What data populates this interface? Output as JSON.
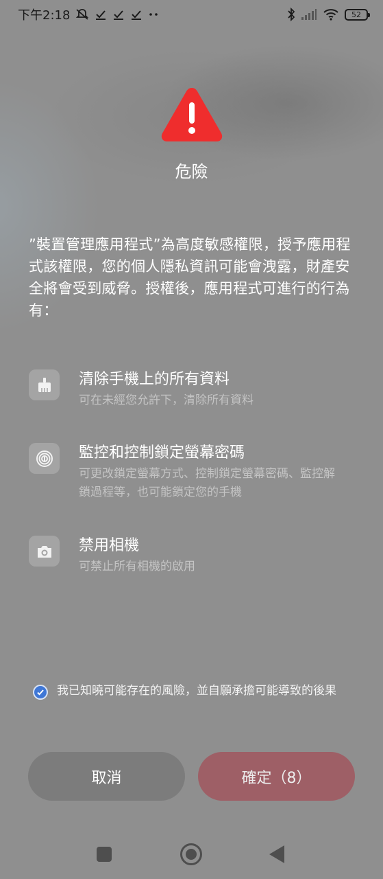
{
  "status_bar": {
    "time": "下午2:18",
    "icons": [
      "mute-bell-icon",
      "check-icon",
      "check-icon",
      "check-icon",
      "more-dots-icon"
    ],
    "right_icons": [
      "bluetooth-icon",
      "signal-icon",
      "wifi-icon"
    ],
    "battery": "52"
  },
  "dialog": {
    "icon": "warning-triangle-icon",
    "warning_color": "#ef2d2d",
    "title": "危險",
    "description": "”裝置管理應用程式”為高度敏感權限，授予應用程式該權限，您的個人隱私資訊可能會洩露，財產安全將會受到威脅。授權後，應用程式可進行的行為有：",
    "permissions": [
      {
        "icon": "broom-icon",
        "title": "清除手機上的所有資料",
        "subtitle": "可在未經您允許下，清除所有資料"
      },
      {
        "icon": "fingerprint-icon",
        "title": "監控和控制鎖定螢幕密碼",
        "subtitle": "可更改鎖定螢幕方式、控制鎖定螢幕密碼、監控解鎖過程等，也可能鎖定您的手機"
      },
      {
        "icon": "camera-icon",
        "title": "禁用相機",
        "subtitle": "可禁止所有相機的啟用"
      }
    ],
    "agree_text": "我已知曉可能存在的風險，並自願承擔可能導致的後果",
    "agree_checked": true,
    "cancel_label": "取消",
    "confirm_label": "確定（8）",
    "accent_color": "#3f77d6"
  },
  "nav_bar": {
    "icons": [
      "recents-square-icon",
      "home-circle-icon",
      "back-triangle-icon"
    ]
  }
}
